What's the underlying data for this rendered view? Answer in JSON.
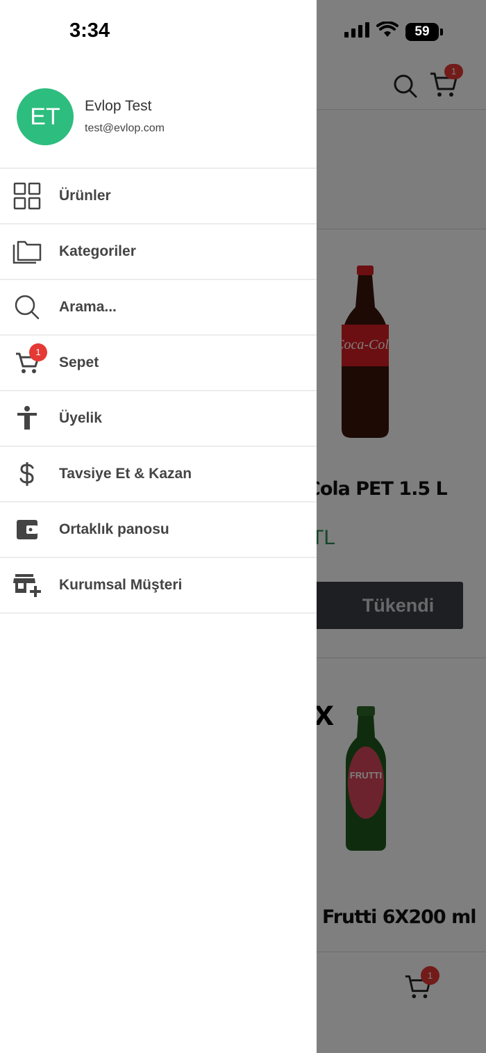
{
  "status_bar": {
    "time": "3:34",
    "battery": "59"
  },
  "drawer": {
    "profile": {
      "initials": "ET",
      "name": "Evlop Test",
      "email": "test@evlop.com"
    },
    "menu_items": [
      {
        "label": "Ürünler",
        "icon": "grid-icon"
      },
      {
        "label": "Kategoriler",
        "icon": "folders-icon"
      },
      {
        "label": "Arama...",
        "icon": "search-icon"
      },
      {
        "label": "Sepet",
        "icon": "cart-icon",
        "badge": "1"
      },
      {
        "label": "Üyelik",
        "icon": "person-icon"
      },
      {
        "label": "Tavsiye Et & Kazan",
        "icon": "dollar-icon"
      },
      {
        "label": "Ortaklık panosu",
        "icon": "wallet-icon"
      },
      {
        "label": "Kurumsal Müşteri",
        "icon": "store-add-icon"
      }
    ]
  },
  "background": {
    "cart_badge": "1",
    "products": [
      {
        "name_visible": "Cola PET 1.5 L",
        "price_visible": "TL",
        "button": "Tükendi"
      },
      {
        "prefix_visible": "x",
        "name_visible": "Frutti 6X200 ml"
      }
    ],
    "bottom_cart_badge": "1"
  },
  "colors": {
    "avatar": "#2dbd7e",
    "badge": "#e53935",
    "price": "#2e8b57",
    "overlay": "rgba(0,0,0,0.5)"
  }
}
